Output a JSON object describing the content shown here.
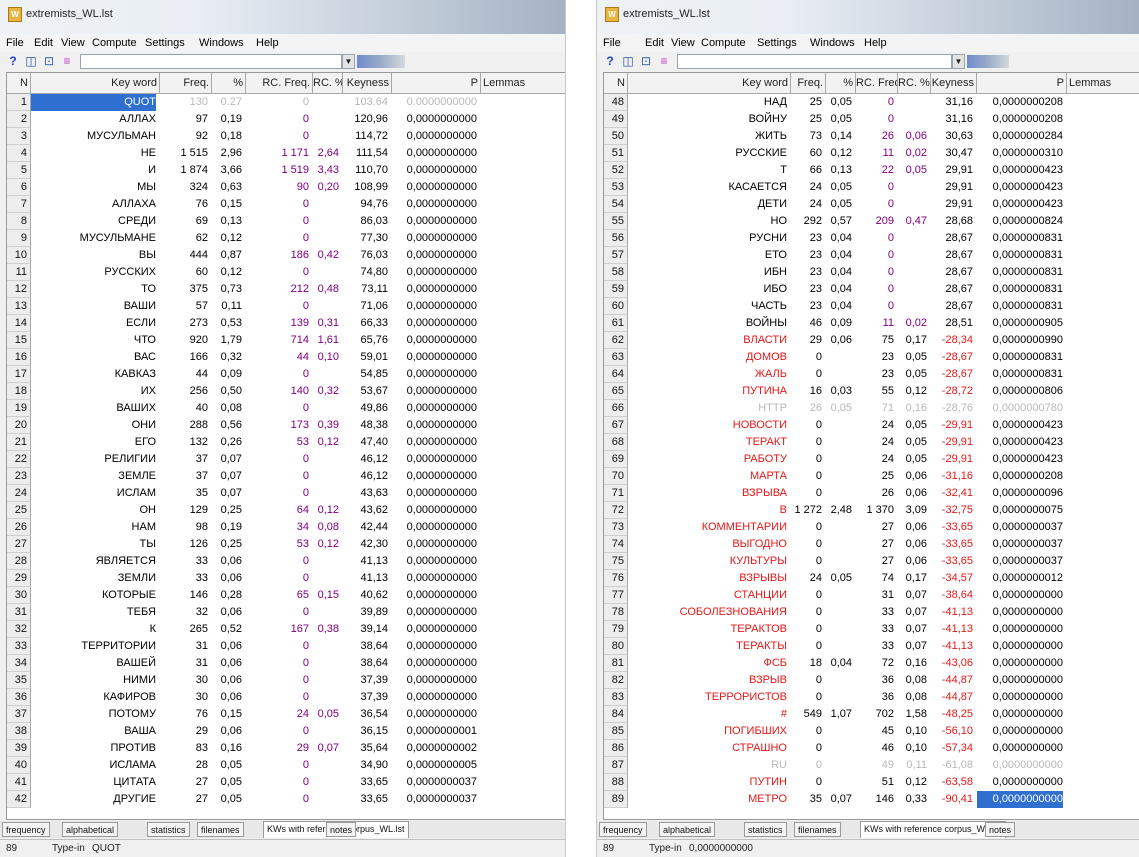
{
  "colors": {
    "positive": "#800080",
    "negative": "#e41818",
    "selection": "#2f6fd0",
    "muted": "#b8b8b8"
  },
  "windows": [
    {
      "title": "extremists_WL.lst",
      "menu": [
        "File",
        "Edit",
        "View",
        "Compute",
        "Settings",
        "Windows",
        "Help"
      ],
      "toolbar_icons": [
        "help-icon",
        "panes-icon",
        "find-icon",
        "equals-icon"
      ],
      "search_value": "",
      "columns": [
        "N",
        "Key word",
        "Freq.",
        "%",
        "RC. Freq.",
        "RC. %",
        "Keyness",
        "P",
        "Lemmas"
      ],
      "rows": [
        [
          "1",
          "QUOT",
          "130",
          "0.27",
          "0",
          "",
          "103.64",
          "0.0000000000"
        ],
        [
          "2",
          "АЛЛАХ",
          "97",
          "0,19",
          "0",
          "",
          "120,96",
          "0,0000000000"
        ],
        [
          "3",
          "МУСУЛЬМАН",
          "92",
          "0,18",
          "0",
          "",
          "114,72",
          "0,0000000000"
        ],
        [
          "4",
          "НЕ",
          "1 515",
          "2,96",
          "1 171",
          "2,64",
          "111,54",
          "0,0000000000"
        ],
        [
          "5",
          "И",
          "1 874",
          "3,66",
          "1 519",
          "3,43",
          "110,70",
          "0,0000000000"
        ],
        [
          "6",
          "МЫ",
          "324",
          "0,63",
          "90",
          "0,20",
          "108,99",
          "0,0000000000"
        ],
        [
          "7",
          "АЛЛАХА",
          "76",
          "0,15",
          "0",
          "",
          "94,76",
          "0,0000000000"
        ],
        [
          "8",
          "СРЕДИ",
          "69",
          "0,13",
          "0",
          "",
          "86,03",
          "0,0000000000"
        ],
        [
          "9",
          "МУСУЛЬМАНЕ",
          "62",
          "0,12",
          "0",
          "",
          "77,30",
          "0,0000000000"
        ],
        [
          "10",
          "ВЫ",
          "444",
          "0,87",
          "186",
          "0,42",
          "76,03",
          "0,0000000000"
        ],
        [
          "11",
          "РУССКИХ",
          "60",
          "0,12",
          "0",
          "",
          "74,80",
          "0,0000000000"
        ],
        [
          "12",
          "ТО",
          "375",
          "0,73",
          "212",
          "0,48",
          "73,11",
          "0,0000000000"
        ],
        [
          "13",
          "ВАШИ",
          "57",
          "0,11",
          "0",
          "",
          "71,06",
          "0,0000000000"
        ],
        [
          "14",
          "ЕСЛИ",
          "273",
          "0,53",
          "139",
          "0,31",
          "66,33",
          "0,0000000000"
        ],
        [
          "15",
          "ЧТО",
          "920",
          "1,79",
          "714",
          "1,61",
          "65,76",
          "0,0000000000"
        ],
        [
          "16",
          "ВАС",
          "166",
          "0,32",
          "44",
          "0,10",
          "59,01",
          "0,0000000000"
        ],
        [
          "17",
          "КАВКАЗ",
          "44",
          "0,09",
          "0",
          "",
          "54,85",
          "0,0000000000"
        ],
        [
          "18",
          "ИХ",
          "256",
          "0,50",
          "140",
          "0,32",
          "53,67",
          "0,0000000000"
        ],
        [
          "19",
          "ВАШИХ",
          "40",
          "0,08",
          "0",
          "",
          "49,86",
          "0,0000000000"
        ],
        [
          "20",
          "ОНИ",
          "288",
          "0,56",
          "173",
          "0,39",
          "48,38",
          "0,0000000000"
        ],
        [
          "21",
          "ЕГО",
          "132",
          "0,26",
          "53",
          "0,12",
          "47,40",
          "0,0000000000"
        ],
        [
          "22",
          "РЕЛИГИИ",
          "37",
          "0,07",
          "0",
          "",
          "46,12",
          "0,0000000000"
        ],
        [
          "23",
          "ЗЕМЛЕ",
          "37",
          "0,07",
          "0",
          "",
          "46,12",
          "0,0000000000"
        ],
        [
          "24",
          "ИСЛАМ",
          "35",
          "0,07",
          "0",
          "",
          "43,63",
          "0,0000000000"
        ],
        [
          "25",
          "ОН",
          "129",
          "0,25",
          "64",
          "0,12",
          "43,62",
          "0,0000000000"
        ],
        [
          "26",
          "НАМ",
          "98",
          "0,19",
          "34",
          "0,08",
          "42,44",
          "0,0000000000"
        ],
        [
          "27",
          "ТЫ",
          "126",
          "0,25",
          "53",
          "0,12",
          "42,30",
          "0,0000000000"
        ],
        [
          "28",
          "ЯВЛЯЕТСЯ",
          "33",
          "0,06",
          "0",
          "",
          "41,13",
          "0,0000000000"
        ],
        [
          "29",
          "ЗЕМЛИ",
          "33",
          "0,06",
          "0",
          "",
          "41,13",
          "0,0000000000"
        ],
        [
          "30",
          "КОТОРЫЕ",
          "146",
          "0,28",
          "65",
          "0,15",
          "40,62",
          "0,0000000000"
        ],
        [
          "31",
          "ТЕБЯ",
          "32",
          "0,06",
          "0",
          "",
          "39,89",
          "0,0000000000"
        ],
        [
          "32",
          "К",
          "265",
          "0,52",
          "167",
          "0,38",
          "39,14",
          "0,0000000000"
        ],
        [
          "33",
          "ТЕРРИТОРИИ",
          "31",
          "0,06",
          "0",
          "",
          "38,64",
          "0,0000000000"
        ],
        [
          "34",
          "ВАШЕЙ",
          "31",
          "0,06",
          "0",
          "",
          "38,64",
          "0,0000000000"
        ],
        [
          "35",
          "НИМИ",
          "30",
          "0,06",
          "0",
          "",
          "37,39",
          "0,0000000000"
        ],
        [
          "36",
          "КАФИРОВ",
          "30",
          "0,06",
          "0",
          "",
          "37,39",
          "0,0000000000"
        ],
        [
          "37",
          "ПОТОМУ",
          "76",
          "0,15",
          "24",
          "0,05",
          "36,54",
          "0,0000000000"
        ],
        [
          "38",
          "ВАША",
          "29",
          "0,06",
          "0",
          "",
          "36,15",
          "0,0000000001"
        ],
        [
          "39",
          "ПРОТИВ",
          "83",
          "0,16",
          "29",
          "0,07",
          "35,64",
          "0,0000000002"
        ],
        [
          "40",
          "ИСЛАМА",
          "28",
          "0,05",
          "0",
          "",
          "34,90",
          "0,0000000005"
        ],
        [
          "41",
          "ЦИТАТА",
          "27",
          "0,05",
          "0",
          "",
          "33,65",
          "0,0000000037"
        ],
        [
          "42",
          "ДРУГИЕ",
          "27",
          "0,05",
          "0",
          "",
          "33,65",
          "0,0000000037"
        ]
      ],
      "tabs": [
        "frequency",
        "alphabetical",
        "statistics",
        "filenames",
        "KWs with reference corpus_WL.lst",
        "notes"
      ],
      "active_tab": 4,
      "status": {
        "n": "89",
        "mode": "Type-in",
        "value": "QUOT"
      }
    },
    {
      "title": "extremists_WL.lst",
      "menu": [
        "File",
        "Edit",
        "View",
        "Compute",
        "Settings",
        "Windows",
        "Help"
      ],
      "toolbar_icons": [
        "help-icon",
        "panes-icon",
        "find-icon",
        "equals-icon"
      ],
      "search_value": "",
      "columns": [
        "N",
        "Key word",
        "Freq.",
        "%",
        "RC. Freq.",
        "RC. %",
        "Keyness",
        "P",
        "Lemmas"
      ],
      "rows": [
        [
          "48",
          "НАД",
          "25",
          "0,05",
          "0",
          "",
          "31,16",
          "0,0000000208"
        ],
        [
          "49",
          "ВОЙНУ",
          "25",
          "0,05",
          "0",
          "",
          "31,16",
          "0,0000000208"
        ],
        [
          "50",
          "ЖИТЬ",
          "73",
          "0,14",
          "26",
          "0,06",
          "30,63",
          "0,0000000284"
        ],
        [
          "51",
          "РУССКИЕ",
          "60",
          "0,12",
          "11",
          "0,02",
          "30,47",
          "0,0000000310"
        ],
        [
          "52",
          "Т",
          "66",
          "0,13",
          "22",
          "0,05",
          "29,91",
          "0,0000000423"
        ],
        [
          "53",
          "КАСАЕТСЯ",
          "24",
          "0,05",
          "0",
          "",
          "29,91",
          "0,0000000423"
        ],
        [
          "54",
          "ДЕТИ",
          "24",
          "0,05",
          "0",
          "",
          "29,91",
          "0,0000000423"
        ],
        [
          "55",
          "НО",
          "292",
          "0,57",
          "209",
          "0,47",
          "28,68",
          "0,0000000824"
        ],
        [
          "56",
          "РУСНИ",
          "23",
          "0,04",
          "0",
          "",
          "28,67",
          "0,0000000831"
        ],
        [
          "57",
          "ЕТО",
          "23",
          "0,04",
          "0",
          "",
          "28,67",
          "0,0000000831"
        ],
        [
          "58",
          "ИБН",
          "23",
          "0,04",
          "0",
          "",
          "28,67",
          "0,0000000831"
        ],
        [
          "59",
          "ИБО",
          "23",
          "0,04",
          "0",
          "",
          "28,67",
          "0,0000000831"
        ],
        [
          "60",
          "ЧАСТЬ",
          "23",
          "0,04",
          "0",
          "",
          "28,67",
          "0,0000000831"
        ],
        [
          "61",
          "ВОЙНЫ",
          "46",
          "0,09",
          "11",
          "0,02",
          "28,51",
          "0,0000000905"
        ],
        [
          "62",
          "ВЛАСТИ",
          "29",
          "0,06",
          "75",
          "0,17",
          "-28,34",
          "0,0000000990"
        ],
        [
          "63",
          "ДОМОВ",
          "0",
          "",
          "23",
          "0,05",
          "-28,67",
          "0,0000000831"
        ],
        [
          "64",
          "ЖАЛЬ",
          "0",
          "",
          "23",
          "0,05",
          "-28,67",
          "0,0000000831"
        ],
        [
          "65",
          "ПУТИНА",
          "16",
          "0,03",
          "55",
          "0,12",
          "-28,72",
          "0,0000000806"
        ],
        [
          "66",
          "HTTP",
          "26",
          "0,05",
          "71",
          "0,16",
          "-28,76",
          "0,0000000780"
        ],
        [
          "67",
          "НОВОСТИ",
          "0",
          "",
          "24",
          "0,05",
          "-29,91",
          "0,0000000423"
        ],
        [
          "68",
          "ТЕРАКТ",
          "0",
          "",
          "24",
          "0,05",
          "-29,91",
          "0,0000000423"
        ],
        [
          "69",
          "РАБОТУ",
          "0",
          "",
          "24",
          "0,05",
          "-29,91",
          "0,0000000423"
        ],
        [
          "70",
          "МАРТА",
          "0",
          "",
          "25",
          "0,06",
          "-31,16",
          "0,0000000208"
        ],
        [
          "71",
          "ВЗРЫВА",
          "0",
          "",
          "26",
          "0,06",
          "-32,41",
          "0,0000000096"
        ],
        [
          "72",
          "В",
          "1 272",
          "2,48",
          "1 370",
          "3,09",
          "-32,75",
          "0,0000000075"
        ],
        [
          "73",
          "КОММЕНТАРИИ",
          "0",
          "",
          "27",
          "0,06",
          "-33,65",
          "0,0000000037"
        ],
        [
          "74",
          "ВЫГОДНО",
          "0",
          "",
          "27",
          "0,06",
          "-33,65",
          "0,0000000037"
        ],
        [
          "75",
          "КУЛЬТУРЫ",
          "0",
          "",
          "27",
          "0,06",
          "-33,65",
          "0,0000000037"
        ],
        [
          "76",
          "ВЗРЫВЫ",
          "24",
          "0,05",
          "74",
          "0,17",
          "-34,57",
          "0,0000000012"
        ],
        [
          "77",
          "СТАНЦИИ",
          "0",
          "",
          "31",
          "0,07",
          "-38,64",
          "0,0000000000"
        ],
        [
          "78",
          "СОБОЛЕЗНОВАНИЯ",
          "0",
          "",
          "33",
          "0,07",
          "-41,13",
          "0,0000000000"
        ],
        [
          "79",
          "ТЕРАКТОВ",
          "0",
          "",
          "33",
          "0,07",
          "-41,13",
          "0,0000000000"
        ],
        [
          "80",
          "ТЕРАКТЫ",
          "0",
          "",
          "33",
          "0,07",
          "-41,13",
          "0,0000000000"
        ],
        [
          "81",
          "ФСБ",
          "18",
          "0,04",
          "72",
          "0,16",
          "-43,06",
          "0,0000000000"
        ],
        [
          "82",
          "ВЗРЫВ",
          "0",
          "",
          "36",
          "0,08",
          "-44,87",
          "0,0000000000"
        ],
        [
          "83",
          "ТЕРРОРИСТОВ",
          "0",
          "",
          "36",
          "0,08",
          "-44,87",
          "0,0000000000"
        ],
        [
          "84",
          "#",
          "549",
          "1,07",
          "702",
          "1,58",
          "-48,25",
          "0,0000000000"
        ],
        [
          "85",
          "ПОГИБШИХ",
          "0",
          "",
          "45",
          "0,10",
          "-56,10",
          "0,0000000000"
        ],
        [
          "86",
          "СТРАШНО",
          "0",
          "",
          "46",
          "0,10",
          "-57,34",
          "0,0000000000"
        ],
        [
          "87",
          "RU",
          "0",
          "",
          "49",
          "0,11",
          "-61,08",
          "0,0000000000"
        ],
        [
          "88",
          "ПУТИН",
          "0",
          "",
          "51",
          "0,12",
          "-63,58",
          "0,0000000000"
        ],
        [
          "89",
          "МЕТРО",
          "35",
          "0,07",
          "146",
          "0,33",
          "-90,41",
          "0,0000000000"
        ]
      ],
      "tabs": [
        "frequency",
        "alphabetical",
        "statistics",
        "filenames",
        "KWs with reference corpus_WL.lst",
        "notes"
      ],
      "active_tab": 4,
      "status": {
        "n": "89",
        "mode": "Type-in",
        "value": "0,0000000000"
      }
    }
  ]
}
